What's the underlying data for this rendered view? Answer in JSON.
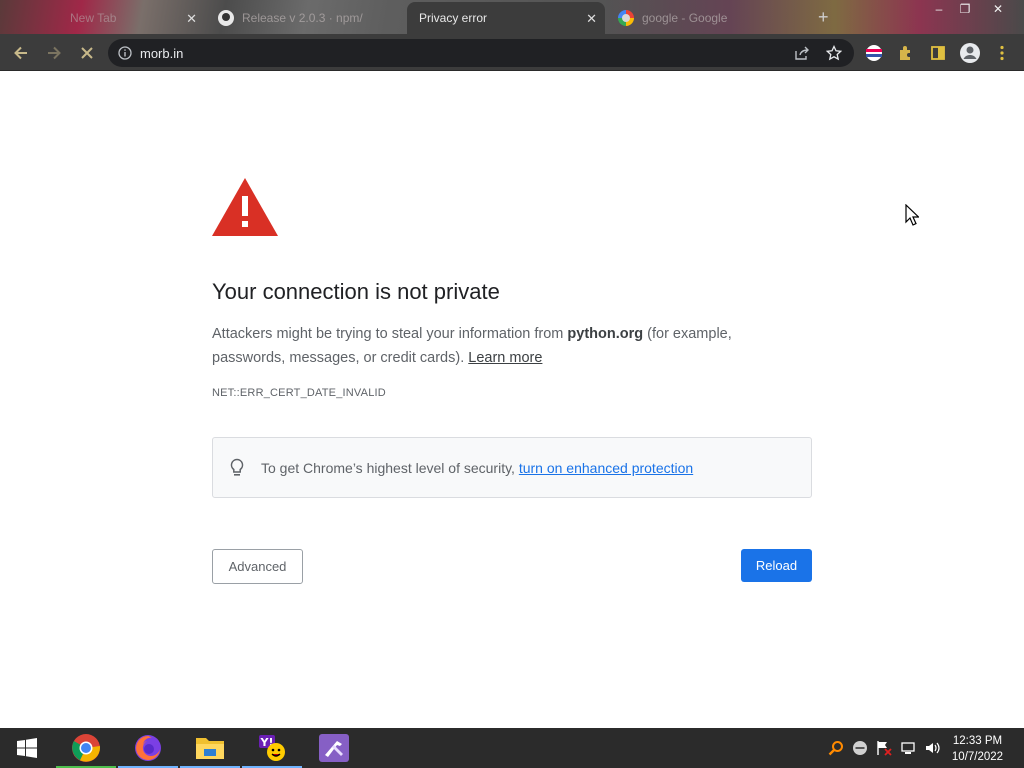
{
  "browser": {
    "tabs": [
      {
        "title": "New Tab",
        "icon": "newtab-icon"
      },
      {
        "title": "Release v 2.0.3 · npm/",
        "icon": "github-icon"
      },
      {
        "title": "Privacy error",
        "icon": "none",
        "active": true
      },
      {
        "title": "google - Google",
        "icon": "google-icon"
      }
    ],
    "new_tab": "+",
    "window_controls": {
      "minimize": "–",
      "restore": "❐",
      "close": "✕"
    },
    "url": "morb.in"
  },
  "page": {
    "heading": "Your connection is not private",
    "desc_part1": "Attackers might be trying to steal your information from ",
    "desc_domain": "python.org",
    "desc_part2": " (for example, passwords, messages, or credit cards). ",
    "learn_more": "Learn more",
    "error_code": "NET::ERR_CERT_DATE_INVALID",
    "tip_text": "To get Chrome’s highest level of security, ",
    "tip_link": "turn on enhanced protection",
    "advanced_label": "Advanced",
    "reload_label": "Reload"
  },
  "taskbar": {
    "apps": [
      "chrome-icon",
      "firefox-icon",
      "file-explorer-icon",
      "yahoo-messenger-icon",
      "visual-studio-icon"
    ],
    "clock_time": "12:33 PM",
    "clock_date": "10/7/2022"
  },
  "colors": {
    "accent": "#1a73e8",
    "warning": "#d93025",
    "toolbar": "#3c3c3c",
    "taskbar": "#2b2b2b"
  }
}
